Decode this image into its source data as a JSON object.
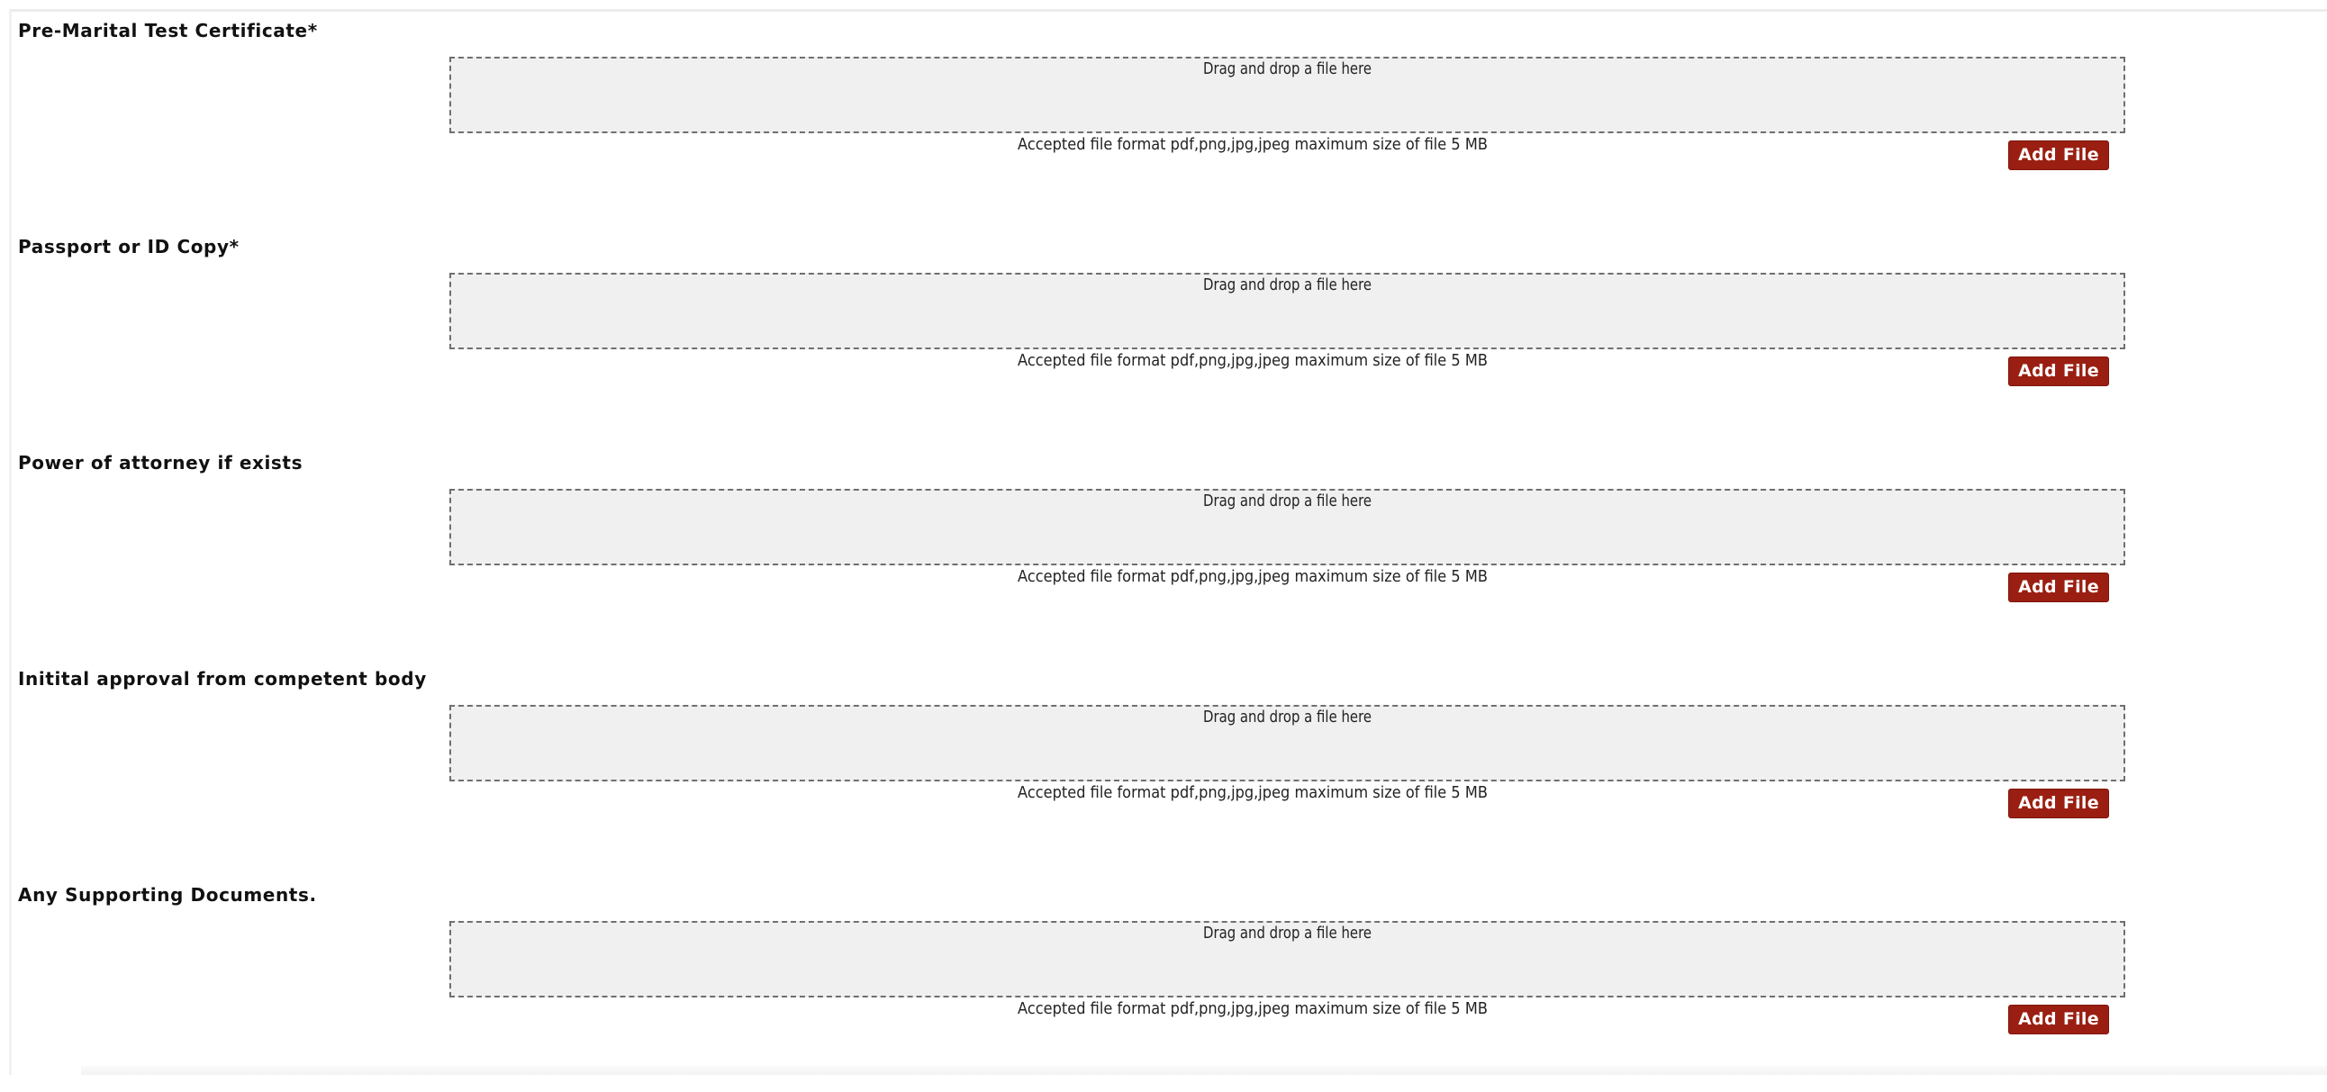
{
  "uploads": [
    {
      "title": "Pre-Marital Test Certificate*",
      "dropzone_text": "Drag and drop a file here",
      "format_hint": "Accepted file format pdf,png,jpg,jpeg maximum size of file 5 MB",
      "button_label": "Add File"
    },
    {
      "title": "Passport or ID Copy*",
      "dropzone_text": "Drag and drop a file here",
      "format_hint": "Accepted file format pdf,png,jpg,jpeg maximum size of file 5 MB",
      "button_label": "Add File"
    },
    {
      "title": "Power of attorney if exists",
      "dropzone_text": "Drag and drop a file here",
      "format_hint": "Accepted file format pdf,png,jpg,jpeg maximum size of file 5 MB",
      "button_label": "Add File"
    },
    {
      "title": "Initital approval from competent body",
      "dropzone_text": "Drag and drop a file here",
      "format_hint": "Accepted file format pdf,png,jpg,jpeg maximum size of file 5 MB",
      "button_label": "Add File"
    },
    {
      "title": "Any Supporting Documents.",
      "dropzone_text": "Drag and drop a file here",
      "format_hint": "Accepted file format pdf,png,jpg,jpeg maximum size of file 5 MB",
      "button_label": "Add File"
    }
  ],
  "colors": {
    "button_bg": "#9a1f12",
    "dropzone_bg": "#f0f0f1",
    "dropzone_border": "#6f6f6f"
  }
}
